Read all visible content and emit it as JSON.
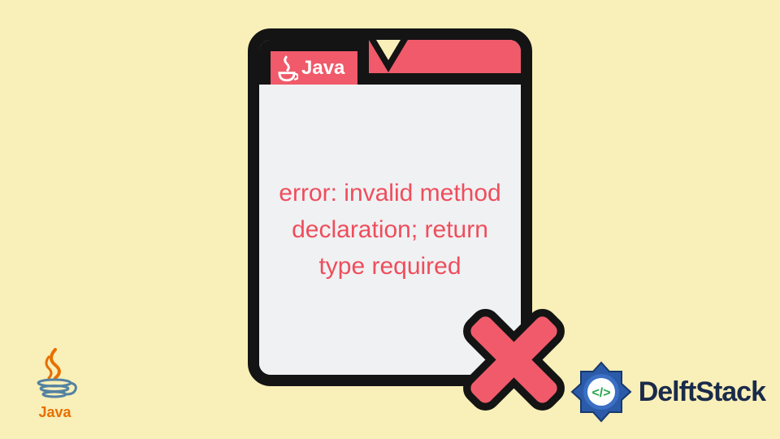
{
  "card": {
    "tab_label": "Java",
    "error_message": "error: invalid method declaration; return type required"
  },
  "branding": {
    "java_label": "Java",
    "site_name": "DelftStack"
  },
  "colors": {
    "bg": "#f9efb8",
    "accent": "#f05a6a",
    "error_text": "#ee4e5c",
    "outline": "#141414"
  }
}
